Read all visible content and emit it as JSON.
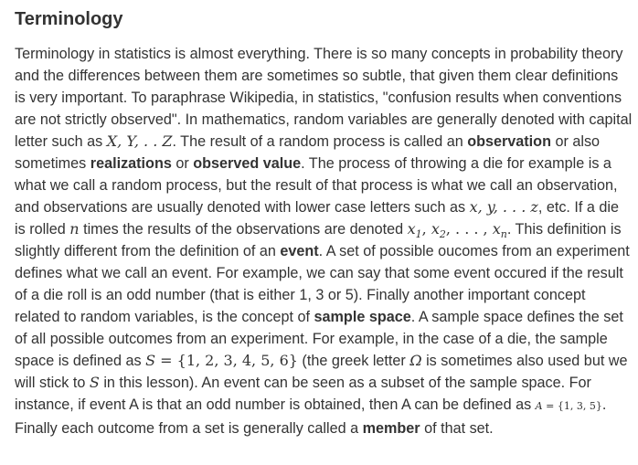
{
  "title": "Terminology",
  "text": {
    "s1": "Terminology in statistics is almost everything. There is so many concepts in probability theory and the differences between them are sometimes so subtle, that given them clear definitions is very important. To paraphrase Wikipedia, in statistics, \"confusion results when conventions are not strictly observed\". In mathematics, random variables are generally denoted with capital letter such as ",
    "m_capitals": "X, Y, . . Z",
    "s2": ". The result of a random process is called an ",
    "t_observation": "observation",
    "s3": " or also sometimes ",
    "t_realizations": "realizations",
    "s4": " or ",
    "t_observed_value": "observed value",
    "s5": ". The process of throwing a die for example is a what we call a random process, but the result of that process is what we call an observation, and observations are usually denoted with lower case letters such as ",
    "m_lower": "x, y, . . . z",
    "s6": ", etc. If a die is rolled ",
    "m_n": "n",
    "s7": " times the results of the observations are denoted ",
    "m_x": "x",
    "m_sub1": "1",
    "m_sep1": ", ",
    "m_sub2": "2",
    "m_sep2": ", . . . , ",
    "m_subn": "n",
    "s8": ". This definition is slightly different from the definition of an ",
    "t_event": "event",
    "s9": ". A set of possible oucomes from an experiment defines what we call an event. For example, we can say that some event occured if the result of a die roll is an odd number (that is either 1, 3 or 5). Finally another important concept related to random variables, is the concept of ",
    "t_sample_space": "sample space",
    "s10": ". A sample space defines the set of all possible outcomes from an experiment. For example, in the case of a die, the sample space is defined as ",
    "m_S": "S",
    "m_S_set": " = {1, 2, 3, 4, 5, 6}",
    "s11": " (the greek letter ",
    "m_omega": "Ω",
    "s12": " is sometimes also used but we will stick to ",
    "m_S2": "S",
    "s13": " in this lesson). An event can be seen as a subset of the sample space. For instance, if event A is that an odd number is obtained, then A can be defined as ",
    "m_A": "A",
    "m_A_set": " = {1, 3, 5}",
    "s14": ". Finally each outcome from a set is generally called a ",
    "t_member": "member",
    "s15": " of that set."
  }
}
